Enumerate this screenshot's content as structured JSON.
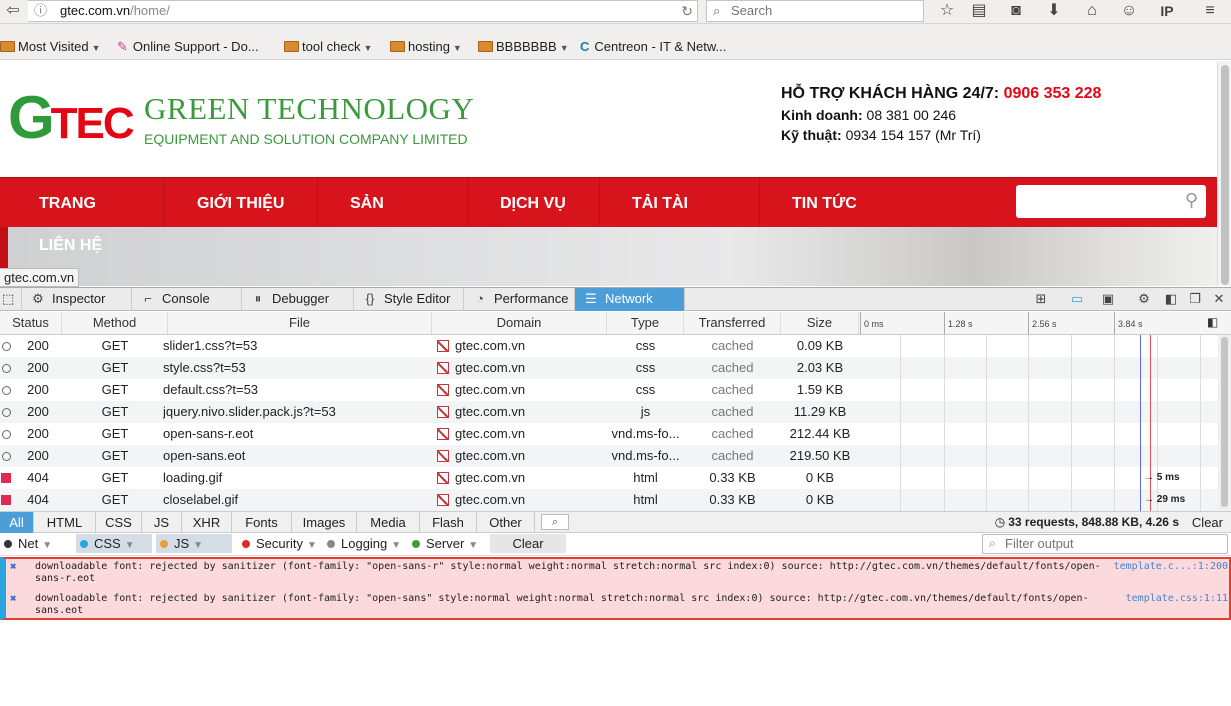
{
  "browser": {
    "url_host": "gtec.com.vn",
    "url_path": "/home/",
    "search_placeholder": "Search"
  },
  "bookmarks": [
    {
      "label": "Most Visited",
      "has_arrow": true
    },
    {
      "label": "Online Support - Do...",
      "has_arrow": false
    },
    {
      "label": "tool check",
      "has_arrow": true
    },
    {
      "label": "hosting",
      "has_arrow": true
    },
    {
      "label": "BBBBBBB",
      "has_arrow": true
    },
    {
      "label": "Centreon - IT & Netw...",
      "has_arrow": false
    }
  ],
  "site": {
    "logo_g": "G",
    "logo_tec": "TEC",
    "company_name": "GREEN TECHNOLOGY",
    "company_sub": "EQUIPMENT AND SOLUTION COMPANY LIMITED",
    "hotline_label": "HỖ TRỢ KHÁCH HÀNG 24/7:",
    "hotline_number": "0906 353 228",
    "sales_label": "Kinh doanh:",
    "sales_number": "08 381 00 246",
    "tech_label": "Kỹ thuật:",
    "tech_number": "0934 154 157 (Mr Trí)",
    "menu": [
      "TRANG CHỦ",
      "GIỚI THIỆU",
      "SẢN PHẨM",
      "DỊCH VỤ",
      "TẢI TÀI LIỆU",
      "TIN TỨC"
    ],
    "menu_lienhe": "LIÊN HỆ",
    "status_tip": "gtec.com.vn"
  },
  "devtools": {
    "tabs": [
      "Inspector",
      "Console",
      "Debugger",
      "Style Editor",
      "Performance",
      "Network"
    ],
    "active_tab": "Network",
    "columns": [
      "Status",
      "Method",
      "File",
      "Domain",
      "Type",
      "Transferred",
      "Size"
    ],
    "ticks": [
      "0 ms",
      "1.28 s",
      "2.56 s",
      "3.84 s"
    ],
    "rows": [
      {
        "status": "200",
        "method": "GET",
        "file": "slider1.css?t=53",
        "domain": "gtec.com.vn",
        "type": "css",
        "transferred": "cached",
        "size": "0.09 KB",
        "timing": "",
        "error": false
      },
      {
        "status": "200",
        "method": "GET",
        "file": "style.css?t=53",
        "domain": "gtec.com.vn",
        "type": "css",
        "transferred": "cached",
        "size": "2.03 KB",
        "timing": "",
        "error": false
      },
      {
        "status": "200",
        "method": "GET",
        "file": "default.css?t=53",
        "domain": "gtec.com.vn",
        "type": "css",
        "transferred": "cached",
        "size": "1.59 KB",
        "timing": "",
        "error": false
      },
      {
        "status": "200",
        "method": "GET",
        "file": "jquery.nivo.slider.pack.js?t=53",
        "domain": "gtec.com.vn",
        "type": "js",
        "transferred": "cached",
        "size": "11.29 KB",
        "timing": "",
        "error": false
      },
      {
        "status": "200",
        "method": "GET",
        "file": "open-sans-r.eot",
        "domain": "gtec.com.vn",
        "type": "vnd.ms-fo...",
        "transferred": "cached",
        "size": "212.44 KB",
        "timing": "",
        "error": false
      },
      {
        "status": "200",
        "method": "GET",
        "file": "open-sans.eot",
        "domain": "gtec.com.vn",
        "type": "vnd.ms-fo...",
        "transferred": "cached",
        "size": "219.50 KB",
        "timing": "",
        "error": false
      },
      {
        "status": "404",
        "method": "GET",
        "file": "loading.gif",
        "domain": "gtec.com.vn",
        "type": "html",
        "transferred": "0.33 KB",
        "size": "0 KB",
        "timing": "→ 5 ms",
        "error": true
      },
      {
        "status": "404",
        "method": "GET",
        "file": "closelabel.gif",
        "domain": "gtec.com.vn",
        "type": "html",
        "transferred": "0.33 KB",
        "size": "0 KB",
        "timing": "→ 29 ms",
        "error": true
      }
    ],
    "filters": [
      "All",
      "HTML",
      "CSS",
      "JS",
      "XHR",
      "Fonts",
      "Images",
      "Media",
      "Flash",
      "Other"
    ],
    "active_filter": "All",
    "summary": "33 requests, 848.88 KB, 4.26 s",
    "clear_label": "Clear"
  },
  "console": {
    "filters": [
      {
        "label": "Net",
        "color": "#333333",
        "pressed": false
      },
      {
        "label": "CSS",
        "color": "#2aa6df",
        "pressed": true
      },
      {
        "label": "JS",
        "color": "#e8a13a",
        "pressed": true
      },
      {
        "label": "Security",
        "color": "#e02a2a",
        "pressed": false
      },
      {
        "label": "Logging",
        "color": "#888888",
        "pressed": false
      },
      {
        "label": "Server",
        "color": "#3aa03a",
        "pressed": false
      }
    ],
    "clear_label": "Clear",
    "filter_placeholder": "Filter output",
    "messages": [
      {
        "text": "downloadable font: rejected by sanitizer (font-family: \"open-sans-r\" style:normal weight:normal stretch:normal src index:0) source: http://gtec.com.vn/themes/default/fonts/open-sans-r.eot",
        "source": "template.c...:1:200"
      },
      {
        "text": "downloadable font: rejected by sanitizer (font-family: \"open-sans\" style:normal weight:normal stretch:normal src index:0) source: http://gtec.com.vn/themes/default/fonts/open-sans.eot",
        "source": "template.css:1:11"
      }
    ]
  },
  "colors": {
    "brand_green": "#3a9a3c",
    "brand_red": "#d7141b",
    "devtools_active": "#4c9ed9",
    "error_bg": "#fcd9dc"
  }
}
